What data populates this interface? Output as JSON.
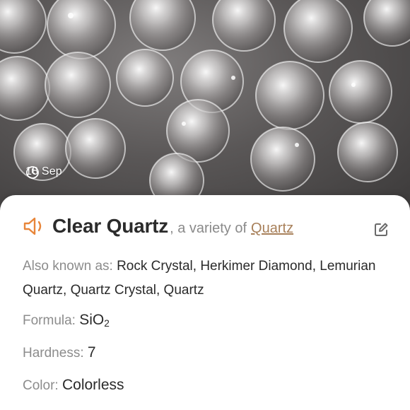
{
  "photo": {
    "date": "18 Sep",
    "clock_icon": "clock-icon"
  },
  "mineral": {
    "name": "Clear Quartz",
    "variety_prefix": ", a variety of",
    "variety_link": "Quartz",
    "speaker_icon": "speaker-icon",
    "edit_icon": "edit-icon",
    "accent_color": "#e8863a"
  },
  "details": {
    "aka_label": "Also known as:",
    "aka_value": "Rock Crystal, Herkimer Diamond, Lemurian Quartz, Quartz Crystal, Quartz",
    "formula_label": "Formula:",
    "formula_main": "SiO",
    "formula_sub": "2",
    "hardness_label": "Hardness:",
    "hardness_value": "7",
    "color_label": "Color:",
    "color_value": "Colorless"
  }
}
